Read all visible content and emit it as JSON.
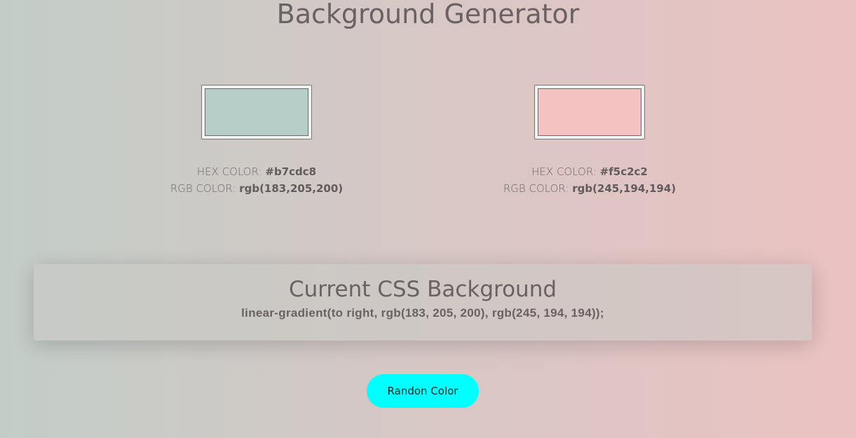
{
  "header": {
    "title": "Background Generator"
  },
  "colors": {
    "left": {
      "label_hex": "HEX COLOR:",
      "hex": "#b7cdc8",
      "label_rgb": "RGB COLOR:",
      "rgb": "rgb(183,205,200)",
      "swatch": "#b7cdc8"
    },
    "right": {
      "label_hex": "HEX COLOR:",
      "hex": "#f5c2c2",
      "label_rgb": "RGB COLOR:",
      "rgb": "rgb(245,194,194)",
      "swatch": "#f5c2c2"
    }
  },
  "css_panel": {
    "title": "Current CSS Background",
    "value": "linear-gradient(to right, rgb(183, 205, 200), rgb(245, 194, 194));"
  },
  "actions": {
    "random_label": "Randon Color"
  },
  "theme": {
    "button_color": "#00ffff"
  }
}
